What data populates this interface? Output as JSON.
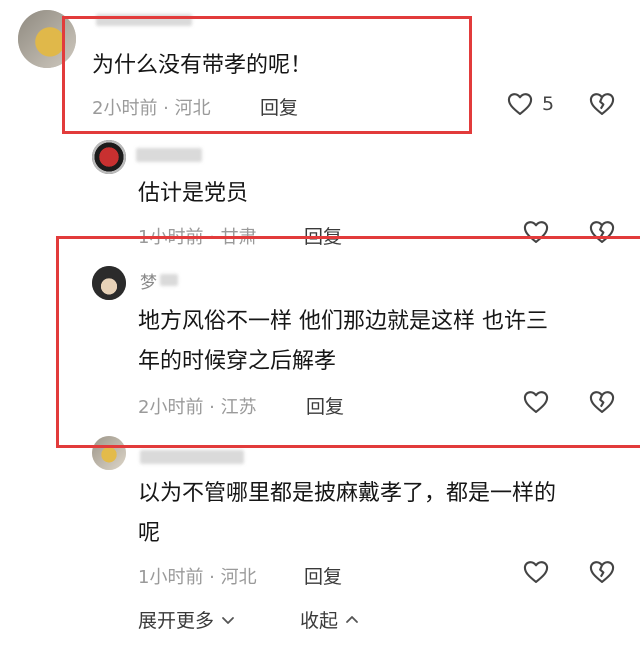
{
  "comments": [
    {
      "content": "为什么没有带孝的呢！",
      "time_location": "2小时前 · 河北",
      "reply_label": "回复",
      "like_count": "5"
    },
    {
      "content": "估计是党员",
      "time_location": "1小时前 · 甘肃",
      "reply_label": "回复"
    },
    {
      "name_initial": "梦",
      "content_line1": "地方风俗不一样  他们那边就是这样  也许三",
      "content_line2": "年的时候穿之后解孝",
      "time_location": "2小时前 · 江苏",
      "reply_label": "回复"
    },
    {
      "content_line1": "以为不管哪里都是披麻戴孝了，都是一样的",
      "content_line2": "呢",
      "time_location": "1小时前 · 河北",
      "reply_label": "回复"
    }
  ],
  "footer": {
    "expand_more": "展开更多",
    "collapse": "收起"
  },
  "colors": {
    "highlight": "#e23b3b",
    "meta_text": "#9a9a9a"
  }
}
